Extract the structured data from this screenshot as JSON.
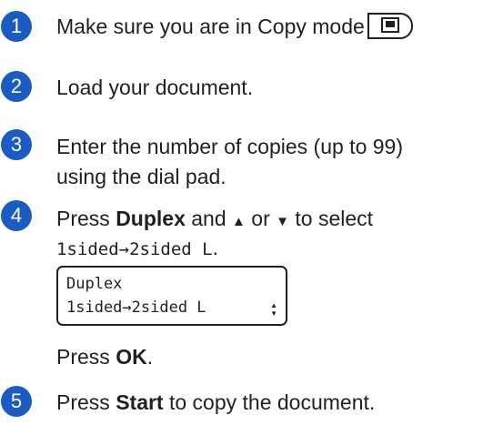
{
  "steps": [
    {
      "number": "1",
      "text": "Make sure you are in Copy mode"
    },
    {
      "number": "2",
      "text": "Load your document."
    },
    {
      "number": "3",
      "line1": "Enter the number of copies (up to 99)",
      "line2": "using the dial pad."
    },
    {
      "number": "4",
      "press": "Press ",
      "key": "Duplex",
      "and": " and ",
      "up_arrow": "▲",
      "or": " or ",
      "down_arrow": "▼",
      "to_select": " to select",
      "option": "1sided→2sided L",
      "option_suffix": "."
    },
    {
      "number": "5",
      "press": "Press ",
      "key": "Start",
      "rest": " to copy the document."
    }
  ],
  "lcd": {
    "line1": "Duplex",
    "line2": "1sided→2sided L",
    "up_arrow": "▲",
    "down_arrow": "▼"
  },
  "press_ok": {
    "press": "Press ",
    "key": "OK",
    "suffix": "."
  },
  "icons": {
    "copy_key": "copy-mode-icon",
    "step_color": "#1a5bc4"
  }
}
